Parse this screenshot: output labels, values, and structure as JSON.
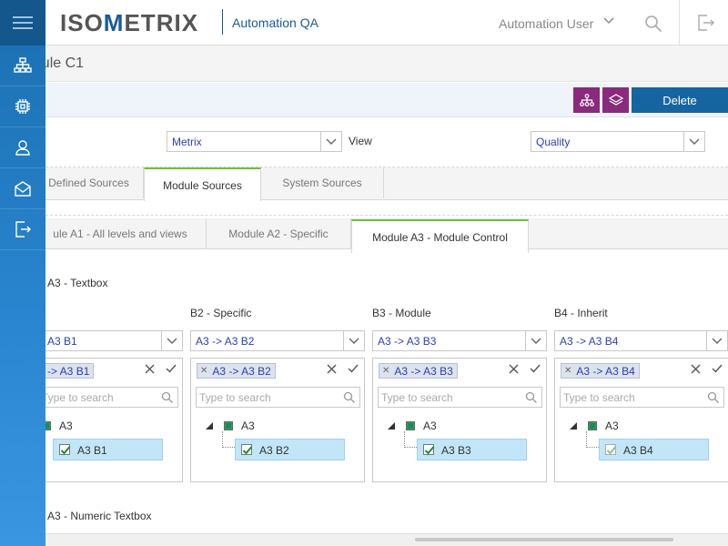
{
  "header": {
    "logo_left": "ISO",
    "logo_mid": "M",
    "logo_right": "ETRIX",
    "app_name": "Automation QA",
    "user_name": "Automation User"
  },
  "page": {
    "title": "odule C1"
  },
  "toolbar": {
    "delete_label": "Delete"
  },
  "filters": {
    "source_value": "Metrix",
    "view_label": "View",
    "view_value": "Quality"
  },
  "tabs_main": [
    {
      "label": "Defined Sources"
    },
    {
      "label": "Module Sources"
    },
    {
      "label": "System Sources"
    }
  ],
  "tabs_sub": [
    {
      "label": "ule A1 - All levels and views"
    },
    {
      "label": "Module A2 - Specific"
    },
    {
      "label": "Module A3 - Module Control"
    }
  ],
  "section_textbox": "A3 - Textbox",
  "section_numeric": "A3 - Numeric Textbox",
  "search_placeholder": "Type to search",
  "columns": [
    {
      "label": "",
      "select_value": "A3 B1",
      "tag": "-> A3 B1",
      "root": "A3",
      "child": "A3 B1",
      "checked": true
    },
    {
      "label": "B2 - Specific",
      "select_value": "A3 -> A3 B2",
      "tag": "A3 -> A3 B2",
      "root": "A3",
      "child": "A3 B2",
      "checked": true
    },
    {
      "label": "B3 - Module",
      "select_value": "A3 -> A3 B3",
      "tag": "A3 -> A3 B3",
      "root": "A3",
      "child": "A3 B3",
      "checked": true
    },
    {
      "label": "B4 - Inherit",
      "select_value": "A3 -> A3 B4",
      "tag": "A3 -> A3 B4",
      "root": "A3",
      "child": "A3 B4",
      "checked": false
    }
  ],
  "colors": {
    "brand": "#1a5a98",
    "sidebar": "#2a86d1",
    "accent_purple": "#8a2a7c",
    "delete_blue": "#1565a0",
    "tab_active": "#6bbf3a",
    "selection": "#c2e6f8"
  }
}
